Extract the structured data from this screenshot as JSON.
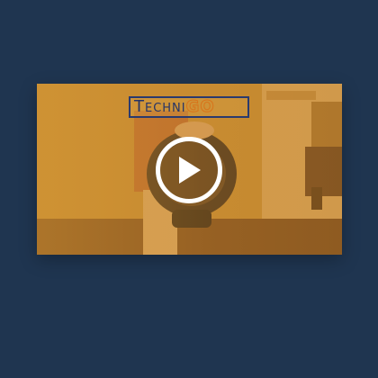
{
  "video": {
    "logo": {
      "main_text": "Techni",
      "accent_text": "GO"
    },
    "play_icon": "play-icon",
    "overlay_color": "#d69834"
  },
  "colors": {
    "page_background": "#1f3550",
    "logo_text": "#263467",
    "logo_accent": "#e8a03a",
    "play_button": "#ffffff"
  }
}
